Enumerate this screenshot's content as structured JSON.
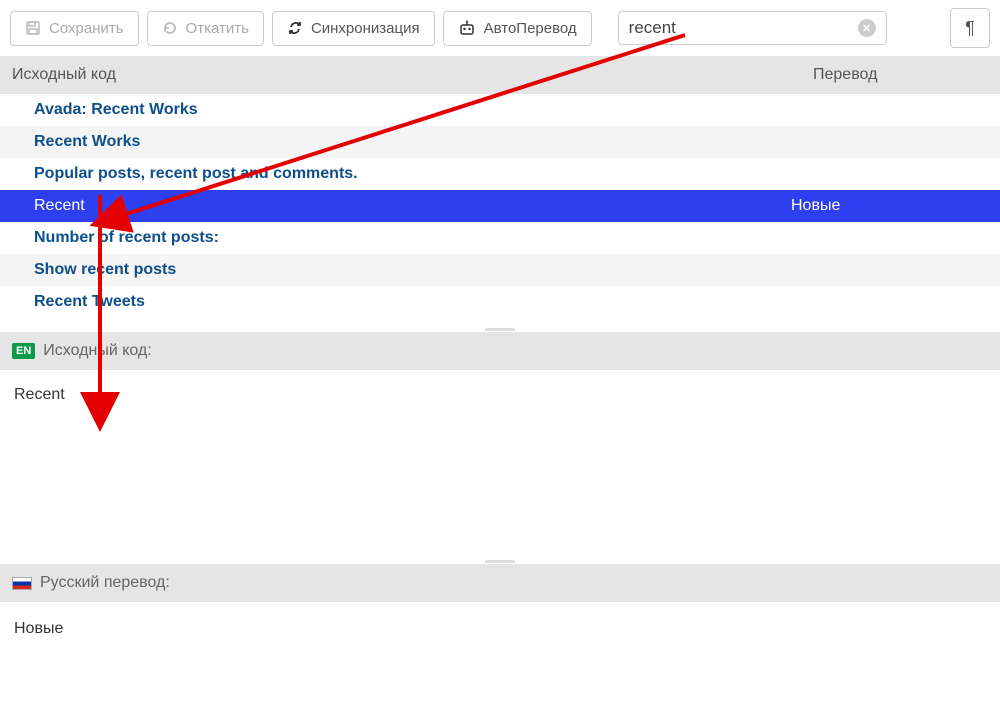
{
  "toolbar": {
    "save": "Сохранить",
    "revert": "Откатить",
    "sync": "Синхронизация",
    "auto_translate": "АвтоПеревод"
  },
  "search": {
    "value": "recent"
  },
  "headers": {
    "source": "Исходный код",
    "translation": "Перевод"
  },
  "rows": [
    {
      "source": "Avada: Recent Works",
      "translation": "",
      "selected": false
    },
    {
      "source": "Recent Works",
      "translation": "",
      "selected": false
    },
    {
      "source": "Popular posts, recent post and comments.",
      "translation": "",
      "selected": false
    },
    {
      "source": "Recent",
      "translation": "Новые",
      "selected": true
    },
    {
      "source": "Number of recent posts:",
      "translation": "",
      "selected": false
    },
    {
      "source": "Show recent posts",
      "translation": "",
      "selected": false
    },
    {
      "source": "Recent Tweets",
      "translation": "",
      "selected": false
    }
  ],
  "source_panel": {
    "label": "Исходный код:",
    "badge": "EN",
    "text": "Recent"
  },
  "translation_panel": {
    "label": "Русский перевод:",
    "text": "Новые"
  }
}
